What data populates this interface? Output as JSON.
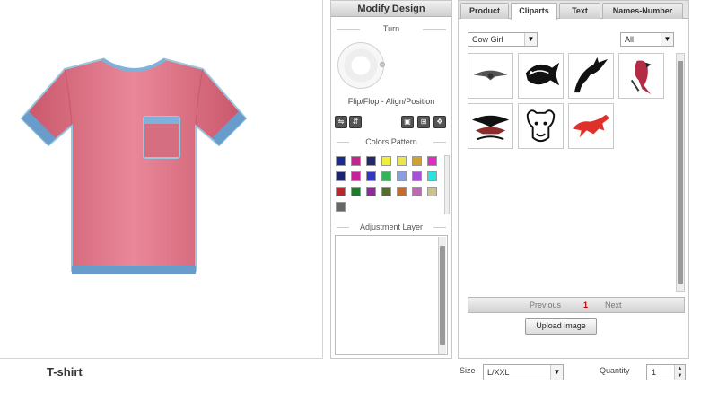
{
  "product": {
    "name": "T-shirt"
  },
  "modify": {
    "header": "Modify Design",
    "turn_title": "Turn",
    "flip_label": "Flip/Flop - Align/Position",
    "colors_title": "Colors Pattern",
    "adjust_title": "Adjustment Layer",
    "swatches": [
      "#1b2a8f",
      "#c02590",
      "#23286f",
      "#f1ee3a",
      "#e8e64a",
      "#cfa130",
      "#e32cc7",
      "#1b2370",
      "#c5219b",
      "#3136c7",
      "#34b35a",
      "#8b9ee0",
      "#a74fd6",
      "#2ae3e2",
      "#b5262e",
      "#1f7a2d",
      "#8e2c9a",
      "#556b2f",
      "#c86a2a",
      "#b86bb1",
      "#c9c28c",
      "#666666"
    ]
  },
  "tabs": [
    {
      "label": "Product"
    },
    {
      "label": "Cliparts"
    },
    {
      "label": "Text"
    },
    {
      "label": "Names-Number"
    }
  ],
  "cliparts": {
    "category": "Cow Girl",
    "filter": "All",
    "items": [
      "winged-emblem",
      "fish",
      "dolphin",
      "parrot",
      "eagle-wings",
      "bull-head",
      "running-cat"
    ]
  },
  "pager": {
    "previous": "Previous",
    "page": "1",
    "next": "Next"
  },
  "upload_label": "Upload image",
  "size": {
    "label": "Size",
    "value": "L/XXL"
  },
  "quantity": {
    "label": "Quantity",
    "value": "1"
  },
  "colors": {
    "shirt": "#d9687a",
    "trim": "#6a9ccb",
    "page_accent": "#c00000"
  }
}
